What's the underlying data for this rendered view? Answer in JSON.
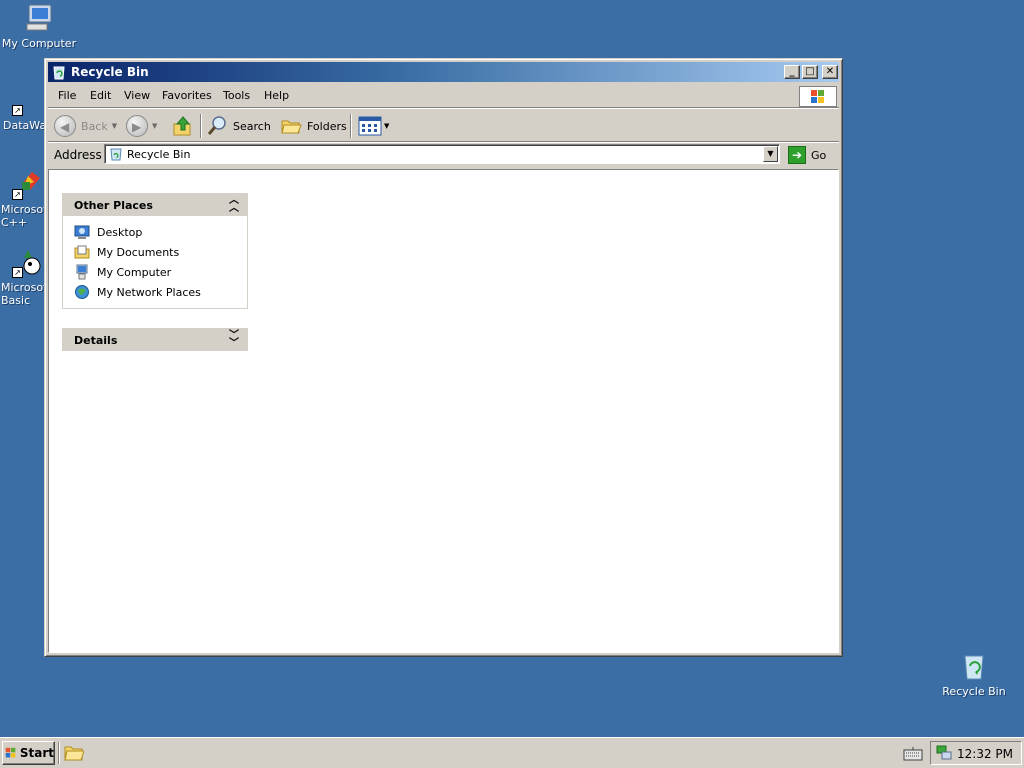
{
  "desktop": {
    "icons": [
      {
        "label": "My Computer"
      },
      {
        "label": "DataWa"
      },
      {
        "label": "Microsoft\nC++"
      },
      {
        "label": "Microsoft\nBasic"
      },
      {
        "label": "Recycle Bin"
      }
    ]
  },
  "window": {
    "title": "Recycle Bin",
    "controls": {
      "minimize": "_",
      "maximize": "□",
      "close": "✕"
    },
    "menu": [
      "File",
      "Edit",
      "View",
      "Favorites",
      "Tools",
      "Help"
    ],
    "toolbar": {
      "back": "Back",
      "search": "Search",
      "folders": "Folders"
    },
    "address": {
      "label": "Address",
      "value": "Recycle Bin",
      "go": "Go"
    },
    "panels": {
      "other_places": {
        "title": "Other Places",
        "items": [
          "Desktop",
          "My Documents",
          "My Computer",
          "My Network Places"
        ]
      },
      "details": {
        "title": "Details"
      }
    }
  },
  "taskbar": {
    "start": "Start",
    "clock": "12:32 PM"
  }
}
